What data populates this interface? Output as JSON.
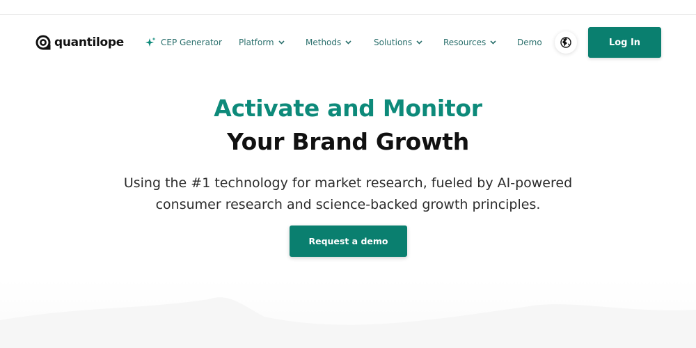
{
  "brand": {
    "name": "quantilope",
    "accent_color": "#0a7f6f",
    "heading_accent_color": "#0d8a7a",
    "nav_text_color": "#2a6f6c"
  },
  "nav": {
    "items": [
      {
        "label": "CEP Generator",
        "icon": "sparkle-icon",
        "dropdown": false
      },
      {
        "label": "Platform",
        "dropdown": true
      },
      {
        "label": "Methods",
        "dropdown": true
      },
      {
        "label": "Solutions",
        "dropdown": true
      },
      {
        "label": "Resources",
        "dropdown": true
      },
      {
        "label": "Demo",
        "dropdown": false
      }
    ],
    "language_icon": "globe-icon",
    "login_label": "Log In"
  },
  "hero": {
    "title_line1": "Activate and Monitor",
    "title_line2": "Your Brand Growth",
    "subtitle": "Using the #1 technology for market research, fueled by AI-powered consumer research and science-backed growth principles.",
    "cta_label": "Request a demo"
  }
}
